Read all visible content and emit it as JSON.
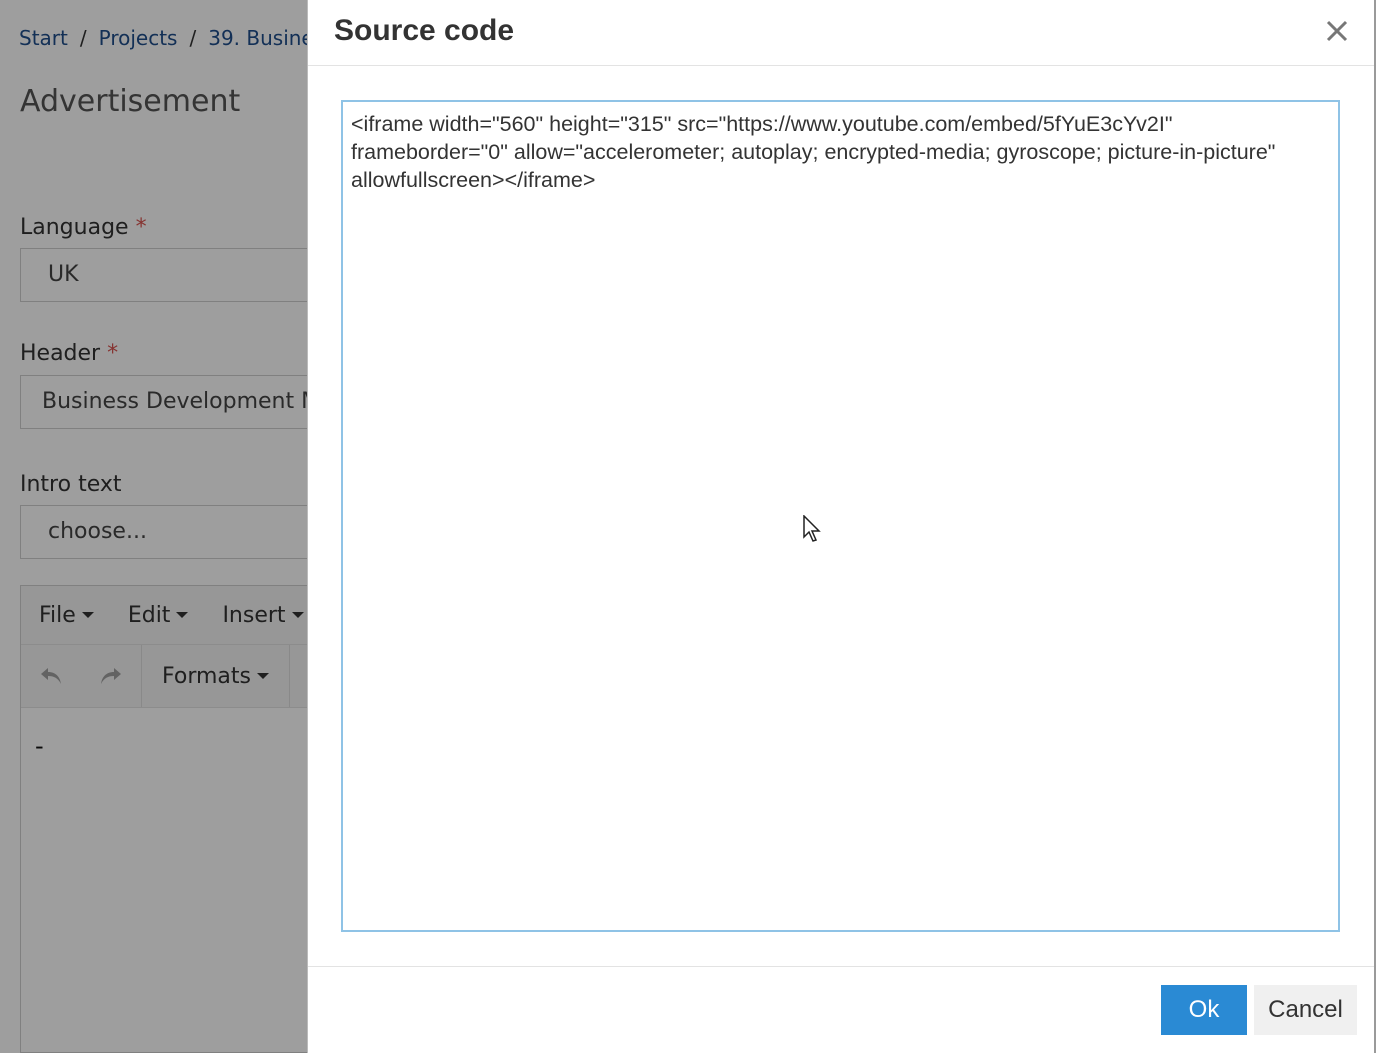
{
  "breadcrumb": {
    "items": [
      "Start",
      "Projects",
      "39. Busine"
    ],
    "separator": "/"
  },
  "page": {
    "title": "Advertisement"
  },
  "form": {
    "language": {
      "label": "Language",
      "required_mark": "*",
      "value": "UK"
    },
    "header": {
      "label": "Header",
      "required_mark": "*",
      "value": "Business Development M"
    },
    "intro": {
      "label": "Intro text",
      "value": "choose..."
    }
  },
  "editor": {
    "menu": [
      "File",
      "Edit",
      "Insert"
    ],
    "toolbar": {
      "undo_icon": "undo-icon",
      "redo_icon": "redo-icon",
      "formats_label": "Formats"
    },
    "content": "-"
  },
  "modal": {
    "title": "Source code",
    "close_icon": "close-icon",
    "source": "<iframe width=\"560\" height=\"315\" src=\"https://www.youtube.com/embed/5fYuE3cYv2I\" frameborder=\"0\" allow=\"accelerometer; autoplay; encrypted-media; gyroscope; picture-in-picture\" allowfullscreen></iframe>",
    "ok_label": "Ok",
    "cancel_label": "Cancel"
  },
  "colors": {
    "primary": "#2a8ad4",
    "link": "#1f4e8c",
    "textarea_border": "#8fc3e6",
    "required": "#d9534f"
  }
}
